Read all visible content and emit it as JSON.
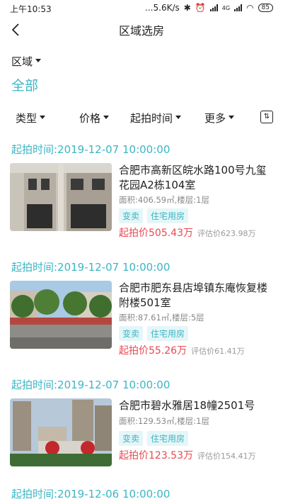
{
  "status": {
    "time": "上午10:53",
    "speed": "...5.6K/s",
    "network": "4G",
    "battery": "85"
  },
  "header": {
    "title": "区域选房"
  },
  "region": {
    "label": "区域",
    "value": "全部"
  },
  "filters": [
    "类型",
    "价格",
    "起拍时间",
    "更多"
  ],
  "listings": [
    {
      "time_header": "起拍时间:2019-12-07 10:00:00",
      "title": "合肥市高新区皖水路100号九玺花园A2栋104室",
      "meta": "面积:406.59㎡,楼层:1层",
      "tags": [
        "变卖",
        "住宅用房"
      ],
      "start_price": "起拍价505.43万",
      "est_price": "评估价623.98万"
    },
    {
      "time_header": "起拍时间:2019-12-07 10:00:00",
      "title": "合肥市肥东县店埠镇东庵恢复楼附楼501室",
      "meta": "面积:87.61㎡,楼层:5层",
      "tags": [
        "变卖",
        "住宅用房"
      ],
      "start_price": "起拍价55.26万",
      "est_price": "评估价61.41万"
    },
    {
      "time_header": "起拍时间:2019-12-07 10:00:00",
      "title": "合肥市碧水雅居18幢2501号",
      "meta": "面积:129.53㎡,楼层:1层",
      "tags": [
        "变卖",
        "住宅用房"
      ],
      "start_price": "起拍价123.53万",
      "est_price": "评估价154.41万"
    }
  ],
  "next_time_header": "起拍时间:2019-12-06 10:00:00",
  "colors": {
    "accent": "#3cb5c4",
    "price": "#e8484f",
    "tag_bg": "#e5f6f8"
  },
  "icons": [
    "back-arrow-icon",
    "sort-icon",
    "caret-down-icon",
    "bluetooth-icon",
    "alarm-icon",
    "signal-icon",
    "wifi-icon",
    "battery-icon"
  ]
}
